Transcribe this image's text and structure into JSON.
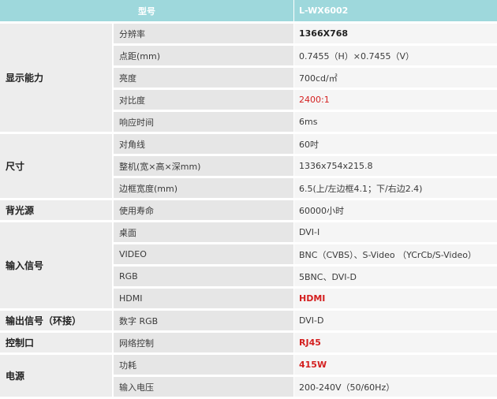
{
  "header": {
    "col_model": "型号",
    "col_model_value": "L-WX6002"
  },
  "groups": [
    {
      "category": "显示能力",
      "rows": [
        {
          "label": "分辨率",
          "value": "1366X768"
        },
        {
          "label": "点距(mm)",
          "value": "0.7455（H）×0.7455（V）"
        },
        {
          "label": "亮度",
          "value": "700cd/㎡"
        },
        {
          "label": "对比度",
          "value": "2400:1"
        },
        {
          "label": "响应时间",
          "value": "6ms"
        }
      ]
    },
    {
      "category": "尺寸",
      "rows": [
        {
          "label": "对角线",
          "value": "60吋"
        },
        {
          "label": "整机(宽×高×深mm)",
          "value": "1336x754x215.8"
        },
        {
          "label": "边框宽度(mm)",
          "value": "6.5(上/左边框4.1；下/右边2.4)"
        }
      ]
    },
    {
      "category": "背光源",
      "rows": [
        {
          "label": "使用寿命",
          "value": "60000小时"
        }
      ]
    },
    {
      "category": "输入信号",
      "rows": [
        {
          "label": "桌面",
          "value": "DVI-I"
        },
        {
          "label": "VIDEO",
          "value": "BNC（CVBS）、S-Video （YCrCb/S-Video）"
        },
        {
          "label": "RGB",
          "value": "5BNC、DVI-D"
        },
        {
          "label": "HDMI",
          "value": "HDMI"
        }
      ]
    },
    {
      "category": "输出信号（环接）",
      "rows": [
        {
          "label": "数字 RGB",
          "value": "DVI-D"
        }
      ]
    },
    {
      "category": "控制口",
      "rows": [
        {
          "label": "网络控制",
          "value": "RJ45"
        }
      ]
    },
    {
      "category": "电源",
      "rows": [
        {
          "label": "功耗",
          "value": "415W"
        },
        {
          "label": "输入电压",
          "value": "200-240V（50/60Hz）"
        }
      ]
    }
  ],
  "colors": {
    "header_bg": "#9ed8dc",
    "highlight_red": "#d42020"
  }
}
